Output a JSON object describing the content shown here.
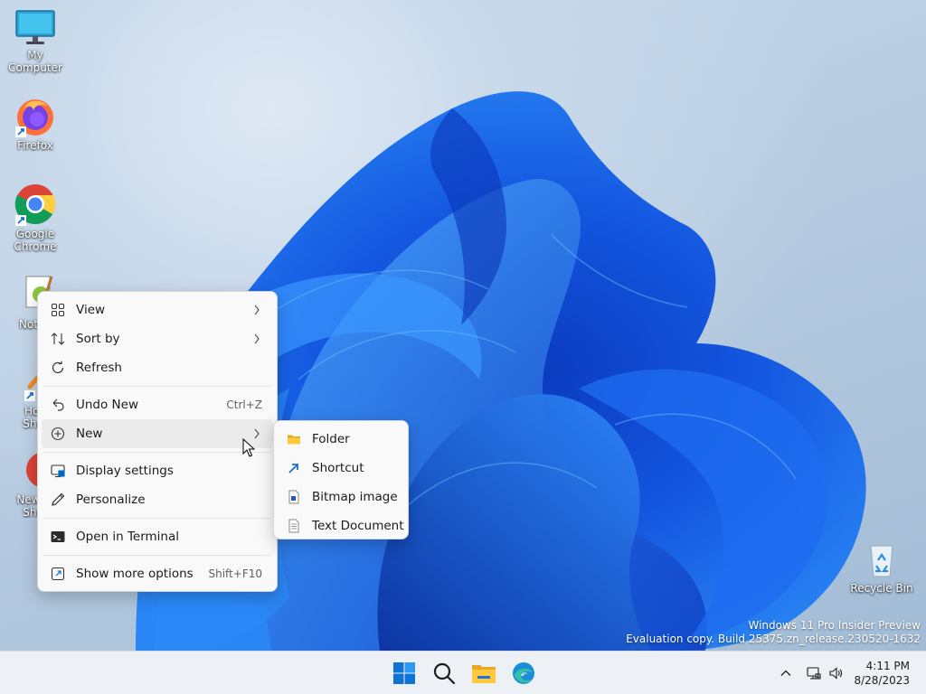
{
  "desktop_icons": [
    {
      "id": "my-computer",
      "label": "My Computer"
    },
    {
      "id": "firefox",
      "label": "Firefox"
    },
    {
      "id": "google-chrome",
      "label": "Google\nChrome"
    },
    {
      "id": "notepad",
      "label": "Notep"
    },
    {
      "id": "home-shortcut",
      "label": "Hon\nShor"
    },
    {
      "id": "new-shortcut",
      "label": "New In\nShor"
    },
    {
      "id": "recycle-bin",
      "label": "Recycle Bin"
    }
  ],
  "context_menu": {
    "items": [
      {
        "label": "View",
        "icon": "grid-icon",
        "submenu": true
      },
      {
        "label": "Sort by",
        "icon": "sort-icon",
        "submenu": true
      },
      {
        "label": "Refresh",
        "icon": "refresh-icon"
      },
      {
        "label": "Undo New",
        "icon": "undo-icon",
        "shortcut": "Ctrl+Z"
      },
      {
        "label": "New",
        "icon": "plus-circle-icon",
        "submenu": true
      },
      {
        "label": "Display settings",
        "icon": "display-icon"
      },
      {
        "label": "Personalize",
        "icon": "pen-icon"
      },
      {
        "label": "Open in Terminal",
        "icon": "terminal-icon"
      },
      {
        "label": "Show more options",
        "icon": "expand-icon",
        "shortcut": "Shift+F10"
      }
    ]
  },
  "new_submenu": {
    "items": [
      {
        "label": "Folder",
        "icon": "folder-icon"
      },
      {
        "label": "Shortcut",
        "icon": "shortcut-icon"
      },
      {
        "label": "Bitmap image",
        "icon": "bitmap-icon"
      },
      {
        "label": "Text Document",
        "icon": "text-document-icon"
      }
    ]
  },
  "watermark": {
    "line1": "Windows 11 Pro Insider Preview",
    "line2": "Evaluation copy. Build 25375.zn_release.230520-1632"
  },
  "taskbar": {
    "apps": [
      "start-icon",
      "search-icon",
      "file-explorer-icon",
      "edge-icon"
    ],
    "time": "4:11 PM",
    "date": "8/28/2023"
  },
  "colors": {
    "accent": "#0067c0",
    "menu_bg": "#f9f9f9",
    "hover": "#ebebeb",
    "taskbar_bg": "#edf1f6"
  }
}
